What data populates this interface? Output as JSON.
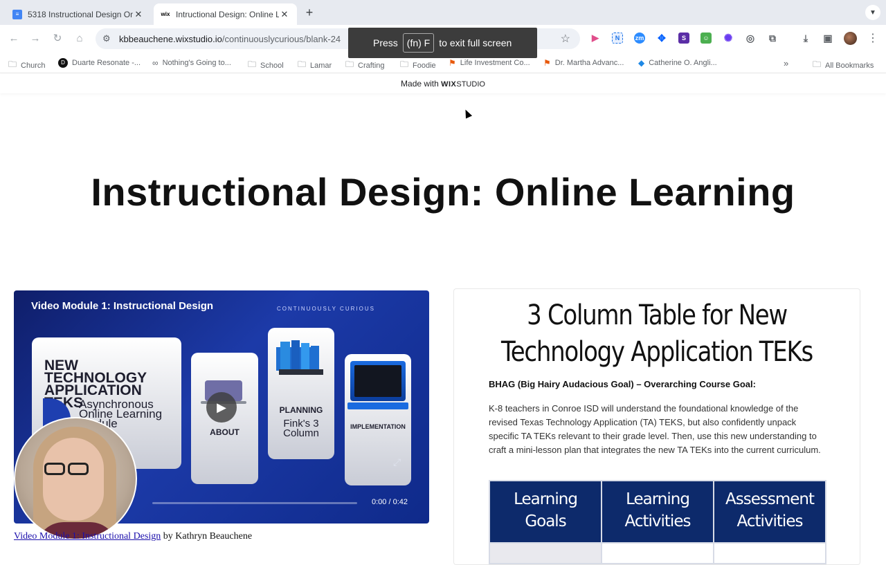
{
  "browser": {
    "tabs": [
      {
        "title": "5318 Instructional Design On",
        "icon": "docs-icon",
        "active": false
      },
      {
        "title": "Intructional Design: Online Le",
        "icon": "wix-icon",
        "active": true
      }
    ],
    "url_host": "kbbeauchene.wixstudio.io",
    "url_path": "/continuouslycurious/blank-24",
    "fullscreen_toast": {
      "prefix": "Press",
      "key": "(fn) F",
      "suffix": "to exit full screen"
    },
    "bookmarks": [
      {
        "label": "Church",
        "icon": "folder-icon"
      },
      {
        "label": "Duarte Resonate -...",
        "icon": "duarte-icon"
      },
      {
        "label": "Nothing's Going to...",
        "icon": "link-icon"
      },
      {
        "label": "School",
        "icon": "folder-icon"
      },
      {
        "label": "Lamar",
        "icon": "folder-icon"
      },
      {
        "label": "Crafting",
        "icon": "folder-icon"
      },
      {
        "label": "Foodie",
        "icon": "folder-icon"
      },
      {
        "label": "Life Investment Co...",
        "icon": "bookmark-icon"
      },
      {
        "label": "Dr. Martha Advanc...",
        "icon": "bookmark-icon"
      },
      {
        "label": "Catherine O. Angli...",
        "icon": "drop-icon"
      }
    ],
    "all_bookmarks": "All Bookmarks"
  },
  "wix_banner": {
    "prefix": "Made with",
    "brand_a": "WIX",
    "brand_b": "STUDIO"
  },
  "page": {
    "title": "Instructional Design: Online Learning"
  },
  "video": {
    "title": "Video Module 1: Instructional Design",
    "brand": "CONTINUOUSLY CURIOUS",
    "card_main_title": "NEW TECHNOLOGY APPLICATION TEKS",
    "card_main_sub": "Asynchronous Online Learning Module",
    "card_about": "ABOUT",
    "card_planning": "PLANNING",
    "card_planning_script": "Fink's 3 Column",
    "card_implementation": "IMPLEMENTATION",
    "time": "0:00 / 0:42",
    "progress": 0.0
  },
  "caption": {
    "link": "Video Module 1: Instructional Design",
    "suffix": " by Kathryn Beauchene"
  },
  "panel": {
    "title": "3 Column Table for New Technology Application TEKs",
    "bhag_label": "BHAG (Big Hairy Audacious Goal) – Overarching Course Goal:",
    "goal_text": "K-8 teachers in Conroe ISD will understand the foundational knowledge of the revised Texas Technology Application (TA) TEKS, but also confidently unpack specific TA TEKs relevant to their grade level. Then, use this new understanding to craft a mini-lesson plan that integrates the new TA TEKs into the current curriculum.",
    "table_headers": [
      "Learning Goals",
      "Learning Activities",
      "Assessment Activities"
    ]
  }
}
